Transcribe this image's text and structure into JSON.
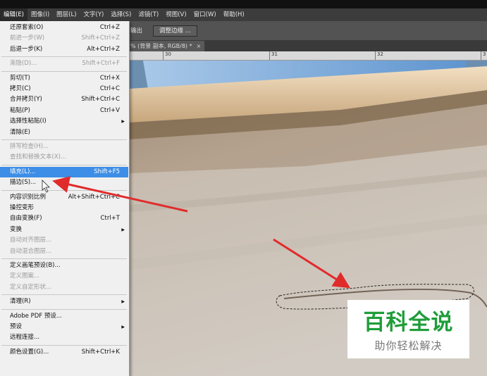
{
  "menubar": {
    "items": [
      {
        "label": "编辑(E)",
        "active": true
      },
      {
        "label": "图像(I)"
      },
      {
        "label": "图层(L)"
      },
      {
        "label": "文字(Y)"
      },
      {
        "label": "选择(S)"
      },
      {
        "label": "滤镜(T)"
      },
      {
        "label": "视图(V)"
      },
      {
        "label": "窗口(W)"
      },
      {
        "label": "帮助(H)"
      }
    ]
  },
  "options": {
    "partial_label": "输出",
    "refine_edge_label": "调整边缘 ..."
  },
  "document_tab": {
    "title": "% (背景 副本, RGB/8) *",
    "close": "×"
  },
  "ruler": {
    "ticks": [
      "30",
      "31",
      "32",
      "3"
    ]
  },
  "edit_menu": {
    "items": [
      {
        "label": "还原套索(O)",
        "shortcut": "Ctrl+Z"
      },
      {
        "label": "前进一步(W)",
        "shortcut": "Shift+Ctrl+Z",
        "disabled": true
      },
      {
        "label": "后退一步(K)",
        "shortcut": "Alt+Ctrl+Z"
      },
      {
        "separator": true
      },
      {
        "label": "渐隐(D)...",
        "shortcut": "Shift+Ctrl+F",
        "disabled": true
      },
      {
        "separator": true
      },
      {
        "label": "剪切(T)",
        "shortcut": "Ctrl+X"
      },
      {
        "label": "拷贝(C)",
        "shortcut": "Ctrl+C"
      },
      {
        "label": "合并拷贝(Y)",
        "shortcut": "Shift+Ctrl+C"
      },
      {
        "label": "粘贴(P)",
        "shortcut": "Ctrl+V"
      },
      {
        "label": "选择性粘贴(I)",
        "submenu": true
      },
      {
        "label": "清除(E)"
      },
      {
        "separator": true
      },
      {
        "label": "拼写检查(H)...",
        "disabled": true
      },
      {
        "label": "查找和替换文本(X)...",
        "disabled": true
      },
      {
        "separator": true
      },
      {
        "label": "填充(L)...",
        "shortcut": "Shift+F5",
        "highlighted": true
      },
      {
        "label": "描边(S)..."
      },
      {
        "separator": true
      },
      {
        "label": "内容识别比例",
        "shortcut": "Alt+Shift+Ctrl+C"
      },
      {
        "label": "操控变形"
      },
      {
        "label": "自由变换(F)",
        "shortcut": "Ctrl+T"
      },
      {
        "label": "变换",
        "submenu": true
      },
      {
        "label": "自动对齐图层...",
        "disabled": true
      },
      {
        "label": "自动混合图层...",
        "disabled": true
      },
      {
        "separator": true
      },
      {
        "label": "定义画笔预设(B)..."
      },
      {
        "label": "定义图案...",
        "disabled": true
      },
      {
        "label": "定义自定形状...",
        "disabled": true
      },
      {
        "separator": true
      },
      {
        "label": "清理(R)",
        "submenu": true
      },
      {
        "separator": true
      },
      {
        "label": "Adobe PDF 预设..."
      },
      {
        "label": "预设",
        "submenu": true
      },
      {
        "label": "远程连接..."
      },
      {
        "separator": true
      },
      {
        "label": "颜色设置(G)...",
        "shortcut": "Shift+Ctrl+K"
      }
    ]
  },
  "watermark": {
    "title": "百科全说",
    "subtitle": "助你轻松解决"
  },
  "colors": {
    "menu_highlight": "#3d8ee6",
    "arrow": "#e02b2b",
    "watermark_green": "#1f9d3a"
  }
}
